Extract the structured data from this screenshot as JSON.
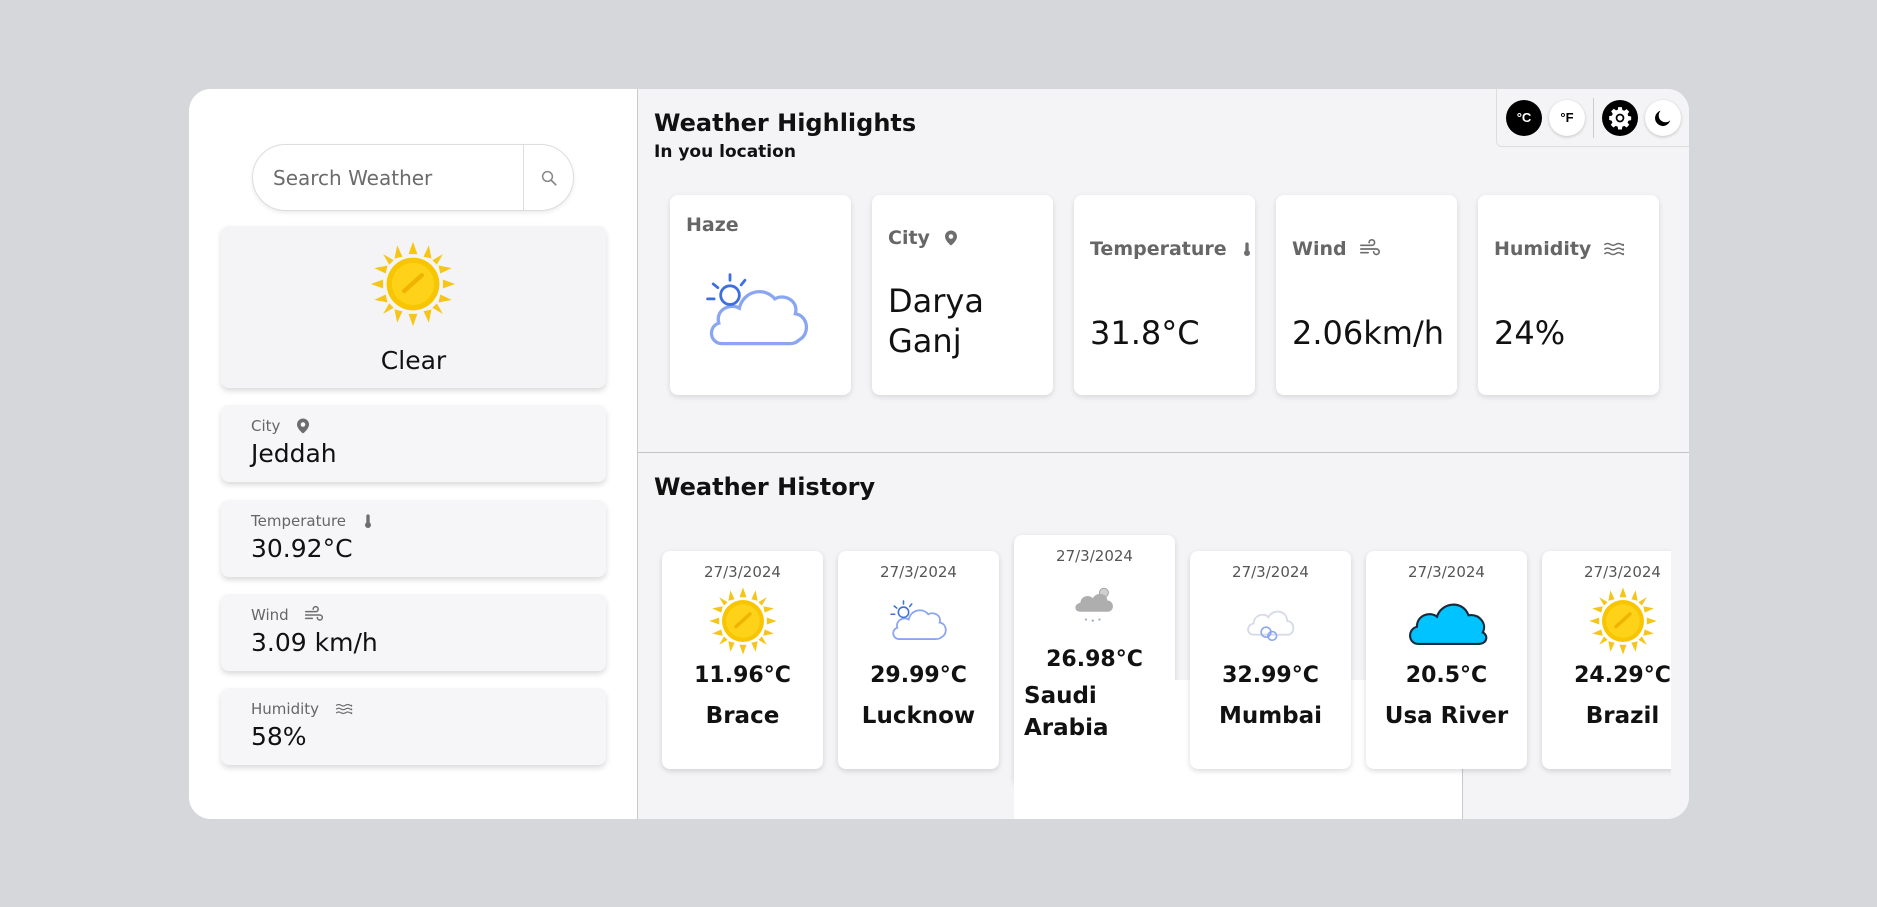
{
  "search": {
    "placeholder": "Search Weather"
  },
  "current": {
    "condition": "Clear",
    "city_label": "City",
    "city": "Jeddah",
    "temperature_label": "Temperature",
    "temperature": "30.92°C",
    "wind_label": "Wind",
    "wind": "3.09 km/h",
    "humidity_label": "Humidity",
    "humidity": "58%"
  },
  "toolbar": {
    "celsius": "°C",
    "fahrenheit": "°F"
  },
  "highlights": {
    "title": "Weather Highlights",
    "subtitle": "In you location",
    "condition_label": "Haze",
    "city_label": "City",
    "city_line1": "Darya",
    "city_line2": "Ganj",
    "temperature_label": "Temperature",
    "temperature": "31.8°C",
    "wind_label": "Wind",
    "wind": "2.06km/h",
    "humidity_label": "Humidity",
    "humidity": "24%"
  },
  "history": {
    "title": "Weather History",
    "items": [
      {
        "date": "27/3/2024",
        "temp": "11.96°C",
        "city": "Brace",
        "icon": "sun-icon"
      },
      {
        "date": "27/3/2024",
        "temp": "29.99°C",
        "city": "Lucknow",
        "icon": "haze-icon"
      },
      {
        "date": "27/3/2024",
        "temp": "26.98°C",
        "city_line1": "Saudi",
        "city_line2": "Arabia",
        "icon": "rain-cloud-icon"
      },
      {
        "date": "27/3/2024",
        "temp": "32.99°C",
        "city": "Mumbai",
        "icon": "mist-icon"
      },
      {
        "date": "27/3/2024",
        "temp": "20.5°C",
        "city": "Usa River",
        "icon": "cloud-icon"
      },
      {
        "date": "27/3/2024",
        "temp": "24.29°C",
        "city": "Brazil",
        "icon": "sun-icon"
      }
    ]
  },
  "colors": {
    "sun": "#f7c600",
    "haze": "#8aa6f2",
    "cloud": "#00c3ff",
    "dark_button": "#000000"
  }
}
